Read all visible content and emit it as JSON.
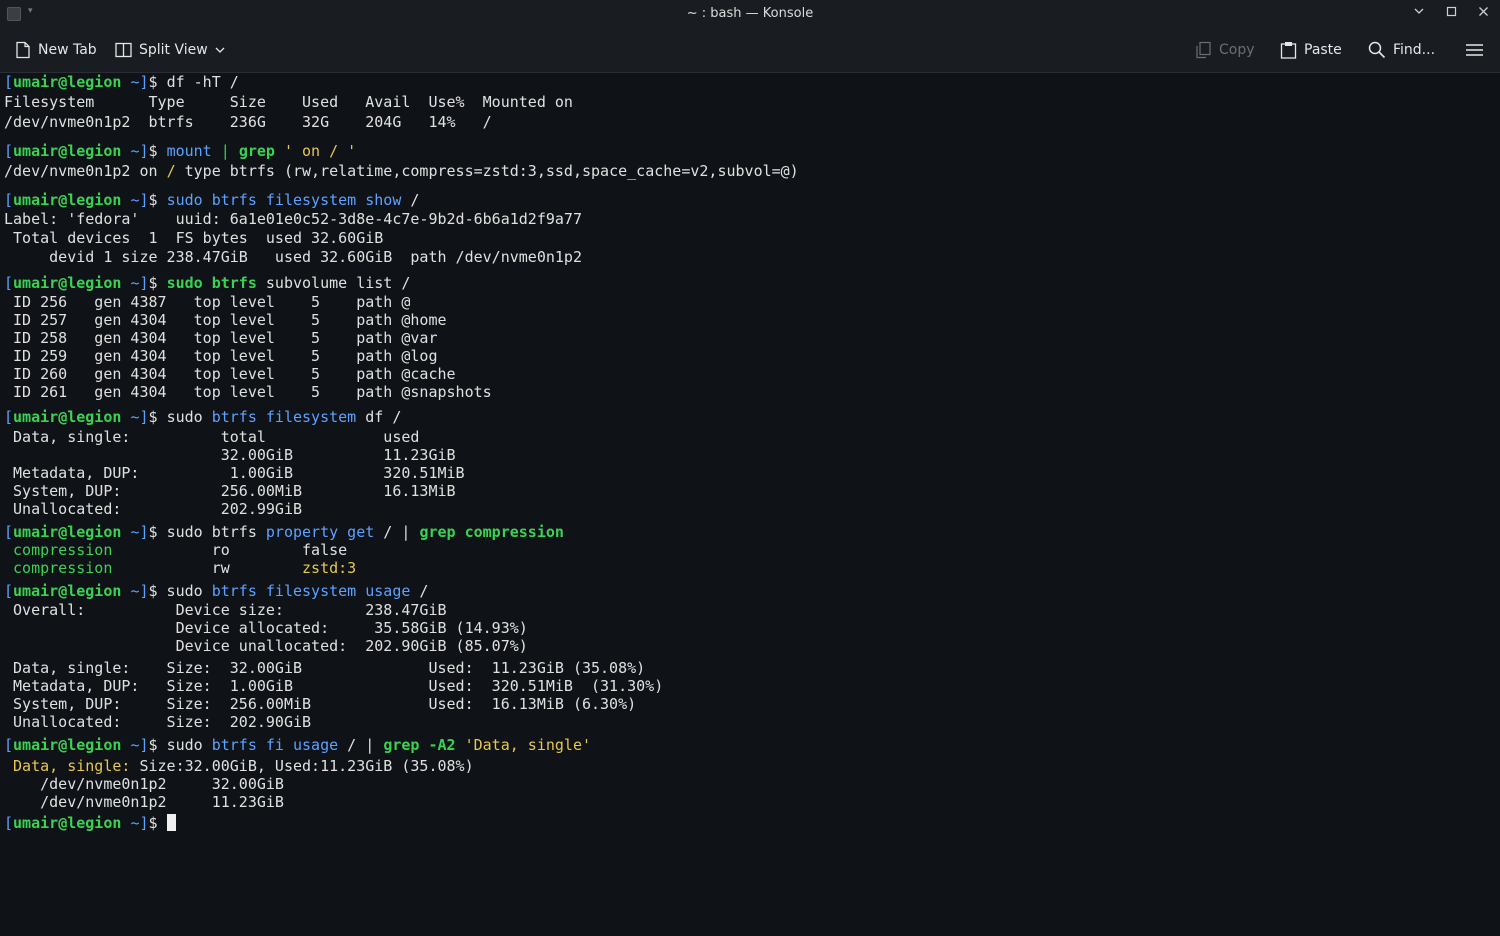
{
  "window": {
    "title": "~ : bash — Konsole"
  },
  "toolbar": {
    "new_tab": "New Tab",
    "split_view": "Split View",
    "copy": "Copy",
    "paste": "Paste",
    "find": "Find..."
  },
  "prompt": {
    "user": "umair",
    "host": "legion",
    "dir": "~"
  },
  "terminal": {
    "l1_cmd": "df -hT /",
    "l2": "Filesystem      Type     Size    Used   Avail  Use%  Mounted on",
    "l3": "/dev/nvme0n1p2  btrfs    236G    32G    204G   14%   /",
    "l4_cmd_mount": "mount",
    "l4_pipe": " | ",
    "l4_grep": "grep",
    "l4_arg": " ' on / '",
    "l5_a": "/dev/nvme0n1p2 on ",
    "l5_slash": "/",
    "l5_b": " type btrfs (rw,relatime,compress=zstd:3,ssd,space_cache=v2,subvol=@)",
    "l6_sudo": "sudo btrfs ",
    "l6_rest": "filesystem show",
    "l6_end": " /",
    "l7": "Label: 'fedora'    uuid: 6a1e01e0c52-3d8e-4c7e-9b2d-6b6a1d2f9a77",
    "l8": " Total devices  1  FS bytes  used 32.60GiB",
    "l9": "     devid 1 size 238.47GiB   used 32.60GiB  path /dev/nvme0n1p2",
    "l10_sudo": "sudo btrfs",
    "l10_rest": " subvolume list /",
    "sub1": " ID 256   gen 4387   top level    5    path @",
    "sub2": " ID 257   gen 4304   top level    5    path @home",
    "sub3": " ID 258   gen 4304   top level    5    path @var",
    "sub4": " ID 259   gen 4304   top level    5    path @log",
    "sub5": " ID 260   gen 4304   top level    5    path @cache",
    "sub6": " ID 261   gen 4304   top level    5    path @snapshots",
    "l17_a": "sudo ",
    "l17_btrfs": "btrfs",
    "l17_fs": " filesystem",
    "l17_rest": " df /",
    "df1": " Data, single:          total             used",
    "df2": "                        32.00GiB          11.23GiB",
    "df3": " Metadata, DUP:          1.00GiB          320.51MiB",
    "df4": " System, DUP:           256.00MiB         16.13MiB",
    "df5": " Unallocated:           202.99GiB",
    "pg_sudo": "sudo btrfs",
    "pg_prop": " property",
    "pg_get": " get",
    "pg_slash": " / | ",
    "pg_grep": "grep compression",
    "pc1_k": " compression",
    "pc1_v": "           ro        false",
    "pc2_k": " compression",
    "pc2_v_a": "           rw        ",
    "pc2_v_b": "zstd:3",
    "us_sudo": " sudo ",
    "us_btrfs": "btrfs filesystem usage",
    "us_end": " /",
    "us1": " Overall:          Device size:         238.47GiB",
    "us2": "                   Device allocated:     35.58GiB (14.93%)",
    "us3": "                   Device unallocated:  202.90GiB (85.07%)",
    "us4": " Data, single:    Size:  32.00GiB              Used:  11.23GiB (35.08%)",
    "us5": " Metadata, DUP:   Size:  1.00GiB               Used:  320.51MiB  (31.30%)",
    "us6": " System, DUP:     Size:  256.00MiB             Used:  16.13MiB (6.30%)",
    "us7": " Unallocated:     Size:  202.90GiB",
    "fi_sudo": "sudo ",
    "fi_btrfs": "btrfs fi usage",
    "fi_mid": " / | ",
    "fi_grep": "grep -A2",
    "fi_arg": " 'Data, single'",
    "fi1_k": " Data, single:",
    "fi1_v": " Size:32.00GiB, Used:11.23GiB (35.08%)",
    "fi2": "    /dev/nvme0n1p2     32.00GiB",
    "fi3": "    /dev/nvme0n1p2     11.23GiB"
  }
}
